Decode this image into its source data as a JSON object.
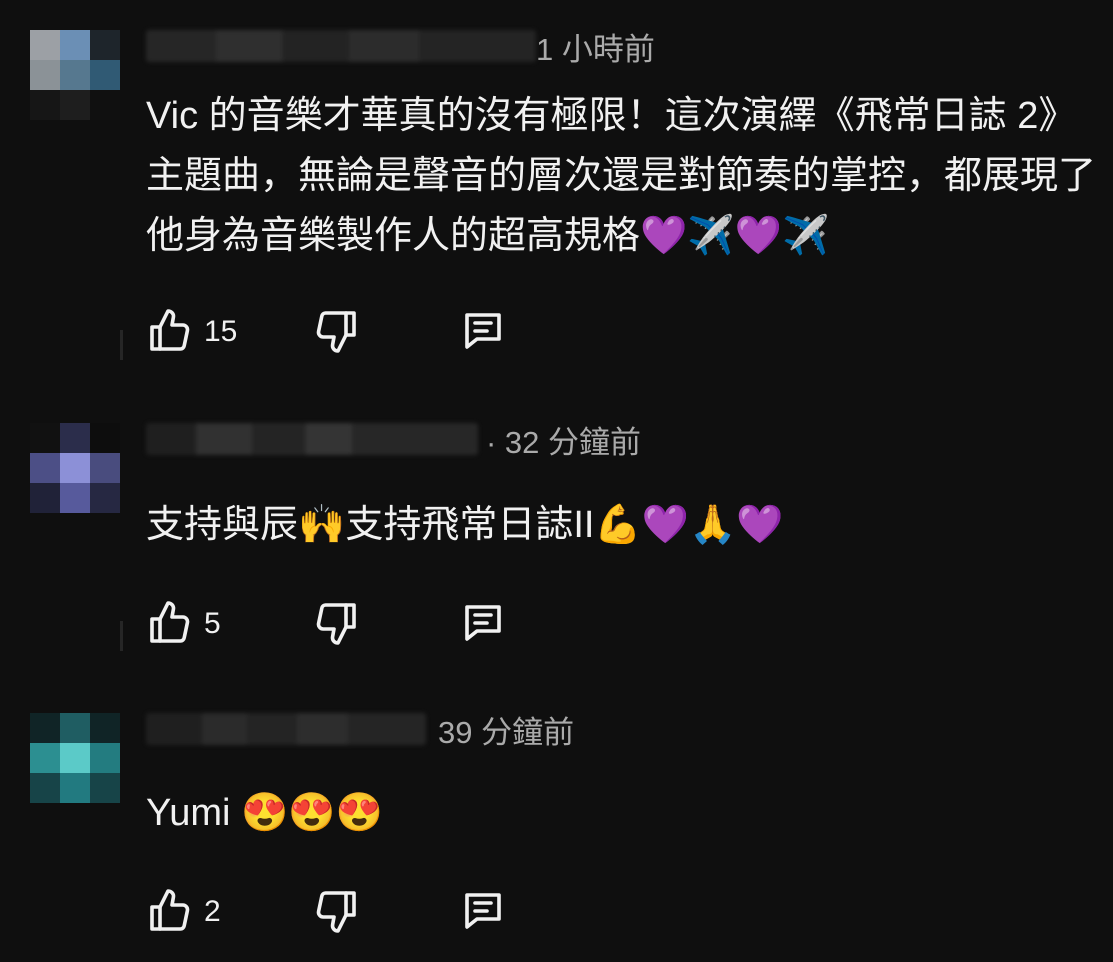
{
  "comments": [
    {
      "timestamp": "1 小時前",
      "text": "Vic 的音樂才華真的沒有極限！這次演繹《飛常日誌 2》主題曲，無論是聲音的層次還是對節奏的掌控，都展現了他身為音樂製作人的超高規格💜✈️💜✈️",
      "like_count": "15"
    },
    {
      "timestamp": "· 32 分鐘前",
      "text": "支持與辰🙌支持飛常日誌II💪💜🙏💜",
      "like_count": "5"
    },
    {
      "timestamp": "39 分鐘前",
      "text": "Yumi 😍😍😍",
      "like_count": "2"
    }
  ],
  "icons": {
    "like": "thumb-up-icon",
    "dislike": "thumb-down-icon",
    "reply": "reply-comment-icon"
  },
  "colors": {
    "background": "#0f0f0f",
    "text": "#f1f1f1",
    "secondary_text": "#aaaaaa"
  }
}
